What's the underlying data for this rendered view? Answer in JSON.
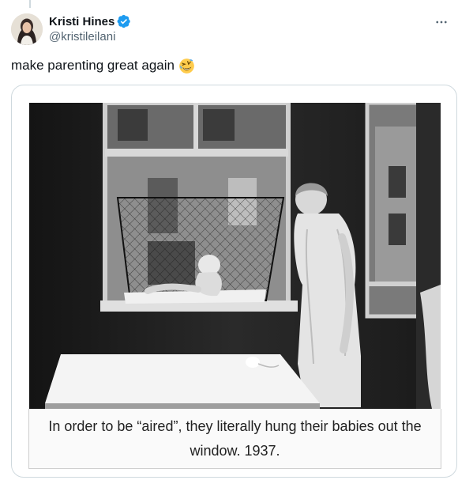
{
  "author": {
    "display_name": "Kristi Hines",
    "handle": "@kristileilani",
    "verified": true,
    "avatar_icon": "profile-photo-avatar"
  },
  "menu_icon": "more-horizontal-icon",
  "tweet": {
    "text": "make parenting great again",
    "emoji": "rolling-on-floor-laughing-emoji"
  },
  "media": {
    "photo_subject": "baby-in-window-cage-photo",
    "caption": "In order to be “aired”, they literally hung their babies out the window. 1937."
  },
  "colors": {
    "verified_blue": "#1d9bf0",
    "text_primary": "#0f1419",
    "text_secondary": "#536471",
    "border": "#cfd9de"
  }
}
